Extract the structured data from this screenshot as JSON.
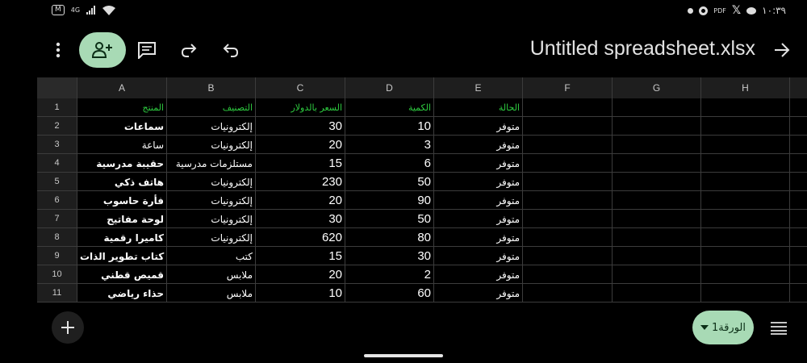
{
  "status_bar": {
    "box_text": "M",
    "network": "4G",
    "time": "١٠:٣٩",
    "pdf_label": "PDF"
  },
  "toolbar": {
    "title": "Untitled spreadsheet.xlsx"
  },
  "grid": {
    "columns": [
      "A",
      "B",
      "C",
      "D",
      "E",
      "F",
      "G",
      "H"
    ],
    "rows": [
      {
        "num": "1",
        "a": "المنتج",
        "b": "التصنيف",
        "c": "السعر بالدولار",
        "d": "الكمية",
        "e": "الحالة"
      },
      {
        "num": "2",
        "a": "سماعات",
        "b": "إلكترونيات",
        "c": "30",
        "d": "10",
        "e": "متوفر"
      },
      {
        "num": "3",
        "a": "ساعة",
        "b": "إلكترونيات",
        "c": "20",
        "d": "3",
        "e": "متوفر"
      },
      {
        "num": "4",
        "a": "حقيبة مدرسية",
        "b": "مستلزمات مدرسية",
        "c": "15",
        "d": "6",
        "e": "متوفر"
      },
      {
        "num": "5",
        "a": "هاتف ذكي",
        "b": "إلكترونيات",
        "c": "230",
        "d": "50",
        "e": "متوفر"
      },
      {
        "num": "6",
        "a": "فأرة حاسوب",
        "b": "إلكترونيات",
        "c": "20",
        "d": "90",
        "e": "متوفر"
      },
      {
        "num": "7",
        "a": "لوحة مفاتيح",
        "b": "إلكترونيات",
        "c": "30",
        "d": "50",
        "e": "متوفر"
      },
      {
        "num": "8",
        "a": "كاميرا رقمية",
        "b": "إلكترونيات",
        "c": "620",
        "d": "80",
        "e": "متوفر"
      },
      {
        "num": "9",
        "a": "كتاب تطوير الذات",
        "b": "كتب",
        "c": "15",
        "d": "30",
        "e": "متوفر"
      },
      {
        "num": "10",
        "a": "قميص قطني",
        "b": "ملابس",
        "c": "20",
        "d": "2",
        "e": "متوفر"
      },
      {
        "num": "11",
        "a": "حذاء رياضي",
        "b": "ملابس",
        "c": "10",
        "d": "60",
        "e": "متوفر"
      }
    ]
  },
  "sheet_tab": {
    "label": "الورقة1"
  },
  "colors": {
    "accent": "#a8dab5",
    "header_text": "#2ecc40",
    "background": "#000000"
  },
  "icons": [
    "more-vert-icon",
    "person-add-icon",
    "comment-icon",
    "redo-icon",
    "undo-icon",
    "arrow-forward-icon",
    "add-icon",
    "dropdown-arrow-icon",
    "menu-lines-icon"
  ]
}
